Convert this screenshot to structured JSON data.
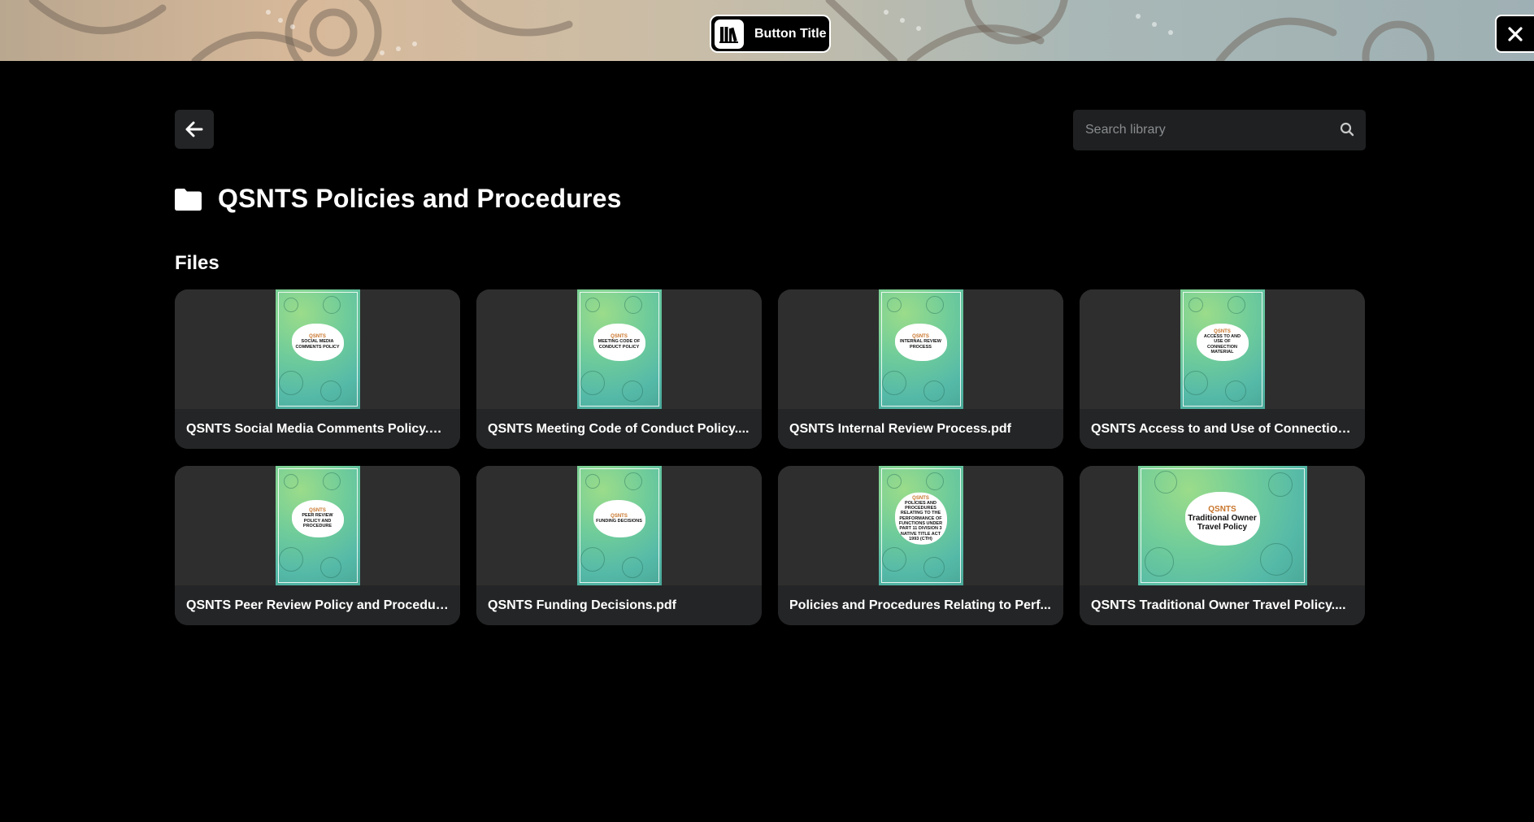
{
  "header": {
    "title_button_label": "Button Title",
    "library_icon": "books-icon",
    "close_icon": "close-icon"
  },
  "toolbar": {
    "back_icon": "arrow-left-icon",
    "search": {
      "placeholder": "Search library",
      "value": "",
      "icon": "search-icon"
    }
  },
  "folder": {
    "icon": "folder-icon",
    "title": "QSNTS Policies and Procedures"
  },
  "files_section": {
    "label": "Files",
    "files": [
      {
        "name": "QSNTS Social Media Comments Policy.pdf",
        "cover_text": "Social Media Comments Policy",
        "logo": "QSNTS"
      },
      {
        "name": "QSNTS Meeting Code of Conduct Policy....",
        "cover_text": "Meeting Code of Conduct Policy",
        "logo": "QSNTS"
      },
      {
        "name": "QSNTS Internal Review Process.pdf",
        "cover_text": "Internal Review Process",
        "logo": "QSNTS"
      },
      {
        "name": "QSNTS Access to and Use of Connection...",
        "cover_text": "Access to and Use of Connection Material",
        "logo": "QSNTS"
      },
      {
        "name": "QSNTS Peer Review Policy and Procedur...",
        "cover_text": "Peer Review Policy and Procedure",
        "logo": "QSNTS"
      },
      {
        "name": "QSNTS Funding Decisions.pdf",
        "cover_text": "Funding Decisions",
        "logo": "QSNTS"
      },
      {
        "name": "Policies and Procedures Relating to Perf...",
        "cover_text": "Policies and Procedures Relating to the Performance of Functions under Part 11 Division 3 Native Title Act 1993 (Cth)",
        "logo": "QSNTS"
      },
      {
        "name": "QSNTS Traditional Owner Travel Policy....",
        "cover_text": "Traditional Owner Travel Policy",
        "logo": "QSNTS",
        "wide": true
      }
    ]
  },
  "colors": {
    "background": "#000000",
    "card": "#2e2e2e",
    "card_label": "#242526",
    "search_bg": "#1e2021",
    "cover_green": "#6fcc9a"
  }
}
